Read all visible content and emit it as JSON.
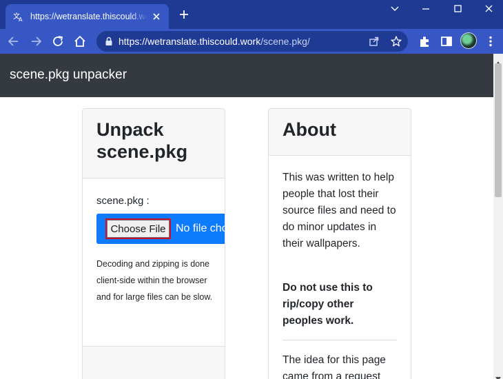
{
  "browser": {
    "tab_title": "https://wetranslate.thiscould.work/scene.pkg/",
    "url_host": "https://wetranslate.thiscould.work",
    "url_path": "/scene.pkg/"
  },
  "navbar": {
    "brand": "scene.pkg unpacker"
  },
  "unpack_card": {
    "title": "Unpack scene.pkg",
    "field_label": "scene.pkg :",
    "choose_file_label": "Choose File",
    "no_file_text": "No file chosen",
    "help_text": "Decoding and zipping is done client-side within the browser and for large files can be slow."
  },
  "about_card": {
    "title": "About",
    "paragraph_1": "This was written to help people that lost their source files and need to do minor updates in their wallpapers.",
    "paragraph_2": "Do not use this to rip/copy other peoples work.",
    "paragraph_3": "The idea for this page came from a request"
  },
  "colors": {
    "titlebar": "#1f3a93",
    "toolbar": "#3657c4",
    "navbar": "#343a40",
    "file_picker": "#0d7bfb",
    "highlight": "#c8102e"
  },
  "icons": [
    "translate-icon",
    "close-icon",
    "plus-icon",
    "minimize-icon",
    "maximize-icon",
    "chevron-down-icon",
    "back-arrow-icon",
    "forward-arrow-icon",
    "reload-icon",
    "home-icon",
    "lock-icon",
    "share-icon",
    "star-icon",
    "extensions-icon",
    "side-panel-icon",
    "kebab-menu-icon"
  ]
}
